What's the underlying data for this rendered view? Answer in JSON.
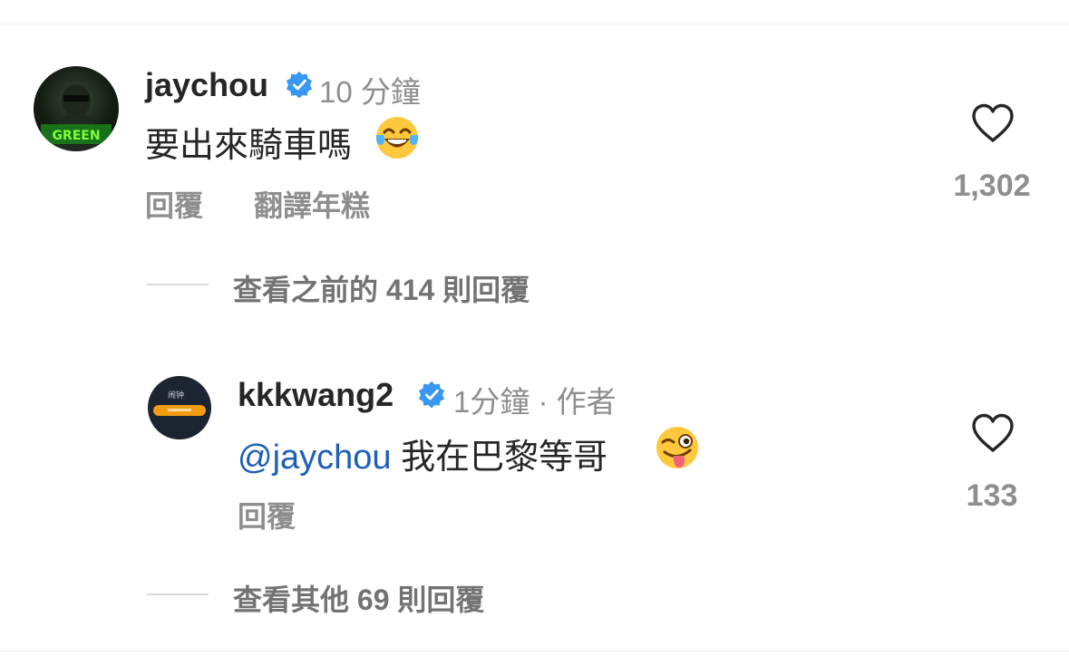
{
  "comment1": {
    "username": "jaychou",
    "time": "10 分鐘",
    "text": "要出來騎車嗎",
    "emoji": "face-with-tears-of-joy",
    "reply_label": "回覆",
    "translate_label": "翻譯年糕",
    "likes": "1,302"
  },
  "view_previous": "查看之前的 414 則回覆",
  "comment2": {
    "username": "kkkwang2",
    "time": "1分鐘 · 作者",
    "mention": "@jaychou",
    "text": " 我在巴黎等哥",
    "emoji": "winking-face-with-tongue",
    "avatar_text": "闹钟",
    "reply_label": "回覆",
    "likes": "133"
  },
  "view_other": "查看其他 69 則回覆",
  "colors": {
    "verified": "#3897f0",
    "mention": "#1d5fb8",
    "muted": "#8e8e8e"
  }
}
